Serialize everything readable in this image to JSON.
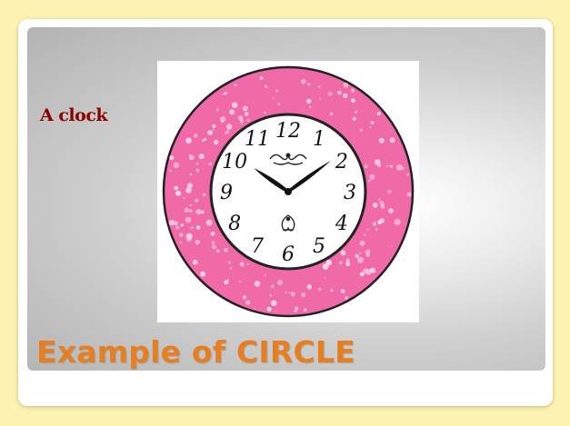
{
  "slide": {
    "caption": "A clock",
    "title": "Example of CIRCLE"
  },
  "clock": {
    "numerals": [
      "12",
      "1",
      "2",
      "3",
      "4",
      "5",
      "6",
      "7",
      "8",
      "9",
      "10",
      "11"
    ],
    "time": {
      "hour": 10,
      "minute": 9
    },
    "rim_color": "#f06aa8",
    "dot_color": "#ffd6ea",
    "face_color": "#ffffff",
    "ink_color": "#111111"
  },
  "colors": {
    "page_background": "#fdf3b0",
    "caption": "#8b0000",
    "title": "#e67e22"
  }
}
